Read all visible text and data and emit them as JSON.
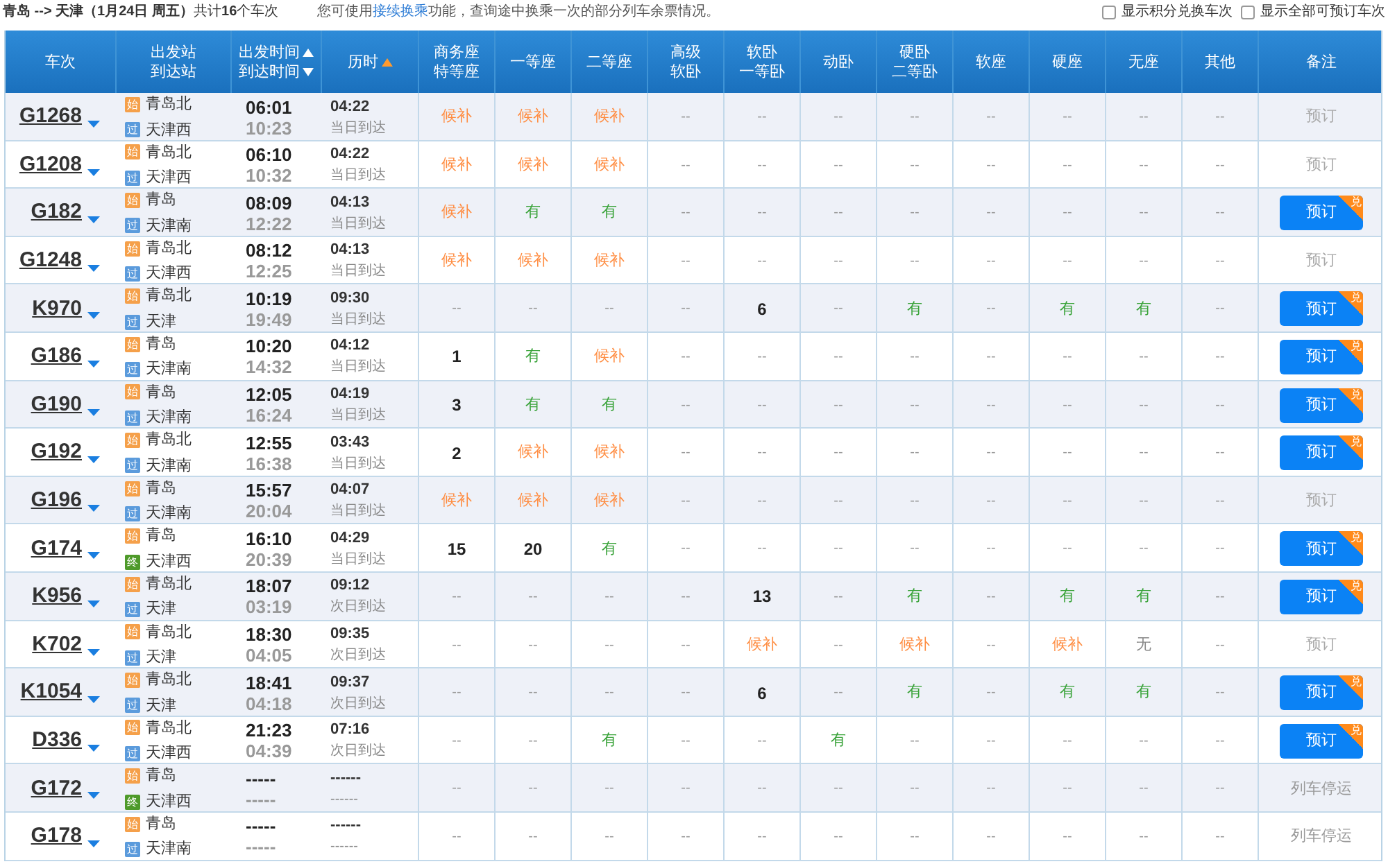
{
  "summary": "**青岛 --> 天津（1月24日 周五）**共计**16**个车次",
  "notice": {
    "before": "您可使用",
    "link": "接续换乘",
    "after": "功能，查询途中换乘一次的部分列车余票情况。"
  },
  "filters": [
    {
      "label": "显示积分兑换车次",
      "checked": false
    },
    {
      "label": "显示全部可预订车次",
      "checked": false
    }
  ],
  "columns": [
    {
      "lines": [
        {
          "text": "车次"
        }
      ]
    },
    {
      "lines": [
        {
          "text": "出发站"
        },
        {
          "text": "到达站"
        }
      ]
    },
    {
      "lines": [
        {
          "text": "出发时间",
          "sorted": true,
          "ascending": true,
          "active": false
        },
        {
          "text": "到达时间",
          "sorted": true,
          "ascending": false,
          "active": false
        }
      ]
    },
    {
      "lines": [
        {
          "text": "历时",
          "sorted": true,
          "ascending": true,
          "active": true
        }
      ]
    },
    {
      "lines": [
        {
          "text": "商务座"
        },
        {
          "text": "特等座"
        }
      ]
    },
    {
      "lines": [
        {
          "text": "一等座"
        }
      ]
    },
    {
      "lines": [
        {
          "text": "二等座"
        }
      ]
    },
    {
      "lines": [
        {
          "text": "高级"
        },
        {
          "text": "软卧"
        }
      ]
    },
    {
      "lines": [
        {
          "text": "软卧"
        },
        {
          "text": "一等卧"
        }
      ]
    },
    {
      "lines": [
        {
          "text": "动卧"
        }
      ]
    },
    {
      "lines": [
        {
          "text": "硬卧"
        },
        {
          "text": "二等卧"
        }
      ]
    },
    {
      "lines": [
        {
          "text": "软座"
        }
      ]
    },
    {
      "lines": [
        {
          "text": "硬座"
        }
      ]
    },
    {
      "lines": [
        {
          "text": "无座"
        }
      ]
    },
    {
      "lines": [
        {
          "text": "其他"
        }
      ]
    },
    {
      "lines": [
        {
          "text": "备注"
        }
      ]
    }
  ],
  "rows": [
    {
      "code": "G1268",
      "from": {
        "tag": "始",
        "kind": "start",
        "name": "青岛北"
      },
      "to": {
        "tag": "过",
        "kind": "pass",
        "name": "天津西"
      },
      "depart": "06:01",
      "arrive": "10:23",
      "duration": "04:22",
      "arrival_day": "当日到达",
      "seats": [
        {
          "text": "候补",
          "kind": "waitlist"
        },
        {
          "text": "候补",
          "kind": "waitlist"
        },
        {
          "text": "候补",
          "kind": "waitlist"
        },
        {
          "text": "--",
          "kind": "none"
        },
        {
          "text": "--",
          "kind": "none"
        },
        {
          "text": "--",
          "kind": "none"
        },
        {
          "text": "--",
          "kind": "none"
        },
        {
          "text": "--",
          "kind": "none"
        },
        {
          "text": "--",
          "kind": "none"
        },
        {
          "text": "--",
          "kind": "none"
        },
        {
          "text": "--",
          "kind": "none"
        }
      ],
      "remark": {
        "kind": "button",
        "text": "预订",
        "enabled": false
      }
    },
    {
      "code": "G1208",
      "from": {
        "tag": "始",
        "kind": "start",
        "name": "青岛北"
      },
      "to": {
        "tag": "过",
        "kind": "pass",
        "name": "天津西"
      },
      "depart": "06:10",
      "arrive": "10:32",
      "duration": "04:22",
      "arrival_day": "当日到达",
      "seats": [
        {
          "text": "候补",
          "kind": "waitlist"
        },
        {
          "text": "候补",
          "kind": "waitlist"
        },
        {
          "text": "候补",
          "kind": "waitlist"
        },
        {
          "text": "--",
          "kind": "none"
        },
        {
          "text": "--",
          "kind": "none"
        },
        {
          "text": "--",
          "kind": "none"
        },
        {
          "text": "--",
          "kind": "none"
        },
        {
          "text": "--",
          "kind": "none"
        },
        {
          "text": "--",
          "kind": "none"
        },
        {
          "text": "--",
          "kind": "none"
        },
        {
          "text": "--",
          "kind": "none"
        }
      ],
      "remark": {
        "kind": "button",
        "text": "预订",
        "enabled": false
      }
    },
    {
      "code": "G182",
      "from": {
        "tag": "始",
        "kind": "start",
        "name": "青岛"
      },
      "to": {
        "tag": "过",
        "kind": "pass",
        "name": "天津南"
      },
      "depart": "08:09",
      "arrive": "12:22",
      "duration": "04:13",
      "arrival_day": "当日到达",
      "seats": [
        {
          "text": "候补",
          "kind": "waitlist"
        },
        {
          "text": "有",
          "kind": "available"
        },
        {
          "text": "有",
          "kind": "available"
        },
        {
          "text": "--",
          "kind": "none"
        },
        {
          "text": "--",
          "kind": "none"
        },
        {
          "text": "--",
          "kind": "none"
        },
        {
          "text": "--",
          "kind": "none"
        },
        {
          "text": "--",
          "kind": "none"
        },
        {
          "text": "--",
          "kind": "none"
        },
        {
          "text": "--",
          "kind": "none"
        },
        {
          "text": "--",
          "kind": "none"
        }
      ],
      "remark": {
        "kind": "button",
        "text": "预订",
        "enabled": true,
        "badge": "兑"
      }
    },
    {
      "code": "G1248",
      "from": {
        "tag": "始",
        "kind": "start",
        "name": "青岛北"
      },
      "to": {
        "tag": "过",
        "kind": "pass",
        "name": "天津西"
      },
      "depart": "08:12",
      "arrive": "12:25",
      "duration": "04:13",
      "arrival_day": "当日到达",
      "seats": [
        {
          "text": "候补",
          "kind": "waitlist"
        },
        {
          "text": "候补",
          "kind": "waitlist"
        },
        {
          "text": "候补",
          "kind": "waitlist"
        },
        {
          "text": "--",
          "kind": "none"
        },
        {
          "text": "--",
          "kind": "none"
        },
        {
          "text": "--",
          "kind": "none"
        },
        {
          "text": "--",
          "kind": "none"
        },
        {
          "text": "--",
          "kind": "none"
        },
        {
          "text": "--",
          "kind": "none"
        },
        {
          "text": "--",
          "kind": "none"
        },
        {
          "text": "--",
          "kind": "none"
        }
      ],
      "remark": {
        "kind": "button",
        "text": "预订",
        "enabled": false
      }
    },
    {
      "code": "K970",
      "from": {
        "tag": "始",
        "kind": "start",
        "name": "青岛北"
      },
      "to": {
        "tag": "过",
        "kind": "pass",
        "name": "天津"
      },
      "depart": "10:19",
      "arrive": "19:49",
      "duration": "09:30",
      "arrival_day": "当日到达",
      "seats": [
        {
          "text": "--",
          "kind": "none"
        },
        {
          "text": "--",
          "kind": "none"
        },
        {
          "text": "--",
          "kind": "none"
        },
        {
          "text": "--",
          "kind": "none"
        },
        {
          "text": "6",
          "kind": "count"
        },
        {
          "text": "--",
          "kind": "none"
        },
        {
          "text": "有",
          "kind": "available"
        },
        {
          "text": "--",
          "kind": "none"
        },
        {
          "text": "有",
          "kind": "available"
        },
        {
          "text": "有",
          "kind": "available"
        },
        {
          "text": "--",
          "kind": "none"
        }
      ],
      "remark": {
        "kind": "button",
        "text": "预订",
        "enabled": true,
        "badge": "兑"
      }
    },
    {
      "code": "G186",
      "from": {
        "tag": "始",
        "kind": "start",
        "name": "青岛"
      },
      "to": {
        "tag": "过",
        "kind": "pass",
        "name": "天津南"
      },
      "depart": "10:20",
      "arrive": "14:32",
      "duration": "04:12",
      "arrival_day": "当日到达",
      "seats": [
        {
          "text": "1",
          "kind": "count"
        },
        {
          "text": "有",
          "kind": "available"
        },
        {
          "text": "候补",
          "kind": "waitlist"
        },
        {
          "text": "--",
          "kind": "none"
        },
        {
          "text": "--",
          "kind": "none"
        },
        {
          "text": "--",
          "kind": "none"
        },
        {
          "text": "--",
          "kind": "none"
        },
        {
          "text": "--",
          "kind": "none"
        },
        {
          "text": "--",
          "kind": "none"
        },
        {
          "text": "--",
          "kind": "none"
        },
        {
          "text": "--",
          "kind": "none"
        }
      ],
      "remark": {
        "kind": "button",
        "text": "预订",
        "enabled": true,
        "badge": "兑"
      }
    },
    {
      "code": "G190",
      "from": {
        "tag": "始",
        "kind": "start",
        "name": "青岛"
      },
      "to": {
        "tag": "过",
        "kind": "pass",
        "name": "天津南"
      },
      "depart": "12:05",
      "arrive": "16:24",
      "duration": "04:19",
      "arrival_day": "当日到达",
      "seats": [
        {
          "text": "3",
          "kind": "count"
        },
        {
          "text": "有",
          "kind": "available"
        },
        {
          "text": "有",
          "kind": "available"
        },
        {
          "text": "--",
          "kind": "none"
        },
        {
          "text": "--",
          "kind": "none"
        },
        {
          "text": "--",
          "kind": "none"
        },
        {
          "text": "--",
          "kind": "none"
        },
        {
          "text": "--",
          "kind": "none"
        },
        {
          "text": "--",
          "kind": "none"
        },
        {
          "text": "--",
          "kind": "none"
        },
        {
          "text": "--",
          "kind": "none"
        }
      ],
      "remark": {
        "kind": "button",
        "text": "预订",
        "enabled": true,
        "badge": "兑"
      }
    },
    {
      "code": "G192",
      "from": {
        "tag": "始",
        "kind": "start",
        "name": "青岛北"
      },
      "to": {
        "tag": "过",
        "kind": "pass",
        "name": "天津南"
      },
      "depart": "12:55",
      "arrive": "16:38",
      "duration": "03:43",
      "arrival_day": "当日到达",
      "seats": [
        {
          "text": "2",
          "kind": "count"
        },
        {
          "text": "候补",
          "kind": "waitlist"
        },
        {
          "text": "候补",
          "kind": "waitlist"
        },
        {
          "text": "--",
          "kind": "none"
        },
        {
          "text": "--",
          "kind": "none"
        },
        {
          "text": "--",
          "kind": "none"
        },
        {
          "text": "--",
          "kind": "none"
        },
        {
          "text": "--",
          "kind": "none"
        },
        {
          "text": "--",
          "kind": "none"
        },
        {
          "text": "--",
          "kind": "none"
        },
        {
          "text": "--",
          "kind": "none"
        }
      ],
      "remark": {
        "kind": "button",
        "text": "预订",
        "enabled": true,
        "badge": "兑"
      }
    },
    {
      "code": "G196",
      "from": {
        "tag": "始",
        "kind": "start",
        "name": "青岛"
      },
      "to": {
        "tag": "过",
        "kind": "pass",
        "name": "天津南"
      },
      "depart": "15:57",
      "arrive": "20:04",
      "duration": "04:07",
      "arrival_day": "当日到达",
      "seats": [
        {
          "text": "候补",
          "kind": "waitlist"
        },
        {
          "text": "候补",
          "kind": "waitlist"
        },
        {
          "text": "候补",
          "kind": "waitlist"
        },
        {
          "text": "--",
          "kind": "none"
        },
        {
          "text": "--",
          "kind": "none"
        },
        {
          "text": "--",
          "kind": "none"
        },
        {
          "text": "--",
          "kind": "none"
        },
        {
          "text": "--",
          "kind": "none"
        },
        {
          "text": "--",
          "kind": "none"
        },
        {
          "text": "--",
          "kind": "none"
        },
        {
          "text": "--",
          "kind": "none"
        }
      ],
      "remark": {
        "kind": "button",
        "text": "预订",
        "enabled": false
      }
    },
    {
      "code": "G174",
      "from": {
        "tag": "始",
        "kind": "start",
        "name": "青岛"
      },
      "to": {
        "tag": "终",
        "kind": "end",
        "name": "天津西"
      },
      "depart": "16:10",
      "arrive": "20:39",
      "duration": "04:29",
      "arrival_day": "当日到达",
      "seats": [
        {
          "text": "15",
          "kind": "count"
        },
        {
          "text": "20",
          "kind": "count"
        },
        {
          "text": "有",
          "kind": "available"
        },
        {
          "text": "--",
          "kind": "none"
        },
        {
          "text": "--",
          "kind": "none"
        },
        {
          "text": "--",
          "kind": "none"
        },
        {
          "text": "--",
          "kind": "none"
        },
        {
          "text": "--",
          "kind": "none"
        },
        {
          "text": "--",
          "kind": "none"
        },
        {
          "text": "--",
          "kind": "none"
        },
        {
          "text": "--",
          "kind": "none"
        }
      ],
      "remark": {
        "kind": "button",
        "text": "预订",
        "enabled": true,
        "badge": "兑"
      }
    },
    {
      "code": "K956",
      "from": {
        "tag": "始",
        "kind": "start",
        "name": "青岛北"
      },
      "to": {
        "tag": "过",
        "kind": "pass",
        "name": "天津"
      },
      "depart": "18:07",
      "arrive": "03:19",
      "duration": "09:12",
      "arrival_day": "次日到达",
      "seats": [
        {
          "text": "--",
          "kind": "none"
        },
        {
          "text": "--",
          "kind": "none"
        },
        {
          "text": "--",
          "kind": "none"
        },
        {
          "text": "--",
          "kind": "none"
        },
        {
          "text": "13",
          "kind": "count"
        },
        {
          "text": "--",
          "kind": "none"
        },
        {
          "text": "有",
          "kind": "available"
        },
        {
          "text": "--",
          "kind": "none"
        },
        {
          "text": "有",
          "kind": "available"
        },
        {
          "text": "有",
          "kind": "available"
        },
        {
          "text": "--",
          "kind": "none"
        }
      ],
      "remark": {
        "kind": "button",
        "text": "预订",
        "enabled": true,
        "badge": "兑"
      }
    },
    {
      "code": "K702",
      "from": {
        "tag": "始",
        "kind": "start",
        "name": "青岛北"
      },
      "to": {
        "tag": "过",
        "kind": "pass",
        "name": "天津"
      },
      "depart": "18:30",
      "arrive": "04:05",
      "duration": "09:35",
      "arrival_day": "次日到达",
      "seats": [
        {
          "text": "--",
          "kind": "none"
        },
        {
          "text": "--",
          "kind": "none"
        },
        {
          "text": "--",
          "kind": "none"
        },
        {
          "text": "--",
          "kind": "none"
        },
        {
          "text": "候补",
          "kind": "waitlist"
        },
        {
          "text": "--",
          "kind": "none"
        },
        {
          "text": "候补",
          "kind": "waitlist"
        },
        {
          "text": "--",
          "kind": "none"
        },
        {
          "text": "候补",
          "kind": "waitlist"
        },
        {
          "text": "无",
          "kind": "soldout"
        },
        {
          "text": "--",
          "kind": "none"
        }
      ],
      "remark": {
        "kind": "button",
        "text": "预订",
        "enabled": false
      }
    },
    {
      "code": "K1054",
      "from": {
        "tag": "始",
        "kind": "start",
        "name": "青岛北"
      },
      "to": {
        "tag": "过",
        "kind": "pass",
        "name": "天津"
      },
      "depart": "18:41",
      "arrive": "04:18",
      "duration": "09:37",
      "arrival_day": "次日到达",
      "seats": [
        {
          "text": "--",
          "kind": "none"
        },
        {
          "text": "--",
          "kind": "none"
        },
        {
          "text": "--",
          "kind": "none"
        },
        {
          "text": "--",
          "kind": "none"
        },
        {
          "text": "6",
          "kind": "count"
        },
        {
          "text": "--",
          "kind": "none"
        },
        {
          "text": "有",
          "kind": "available"
        },
        {
          "text": "--",
          "kind": "none"
        },
        {
          "text": "有",
          "kind": "available"
        },
        {
          "text": "有",
          "kind": "available"
        },
        {
          "text": "--",
          "kind": "none"
        }
      ],
      "remark": {
        "kind": "button",
        "text": "预订",
        "enabled": true,
        "badge": "兑"
      }
    },
    {
      "code": "D336",
      "from": {
        "tag": "始",
        "kind": "start",
        "name": "青岛北"
      },
      "to": {
        "tag": "过",
        "kind": "pass",
        "name": "天津西"
      },
      "depart": "21:23",
      "arrive": "04:39",
      "duration": "07:16",
      "arrival_day": "次日到达",
      "seats": [
        {
          "text": "--",
          "kind": "none"
        },
        {
          "text": "--",
          "kind": "none"
        },
        {
          "text": "有",
          "kind": "available"
        },
        {
          "text": "--",
          "kind": "none"
        },
        {
          "text": "--",
          "kind": "none"
        },
        {
          "text": "有",
          "kind": "available"
        },
        {
          "text": "--",
          "kind": "none"
        },
        {
          "text": "--",
          "kind": "none"
        },
        {
          "text": "--",
          "kind": "none"
        },
        {
          "text": "--",
          "kind": "none"
        },
        {
          "text": "--",
          "kind": "none"
        }
      ],
      "remark": {
        "kind": "button",
        "text": "预订",
        "enabled": true,
        "badge": "兑"
      }
    },
    {
      "code": "G172",
      "from": {
        "tag": "始",
        "kind": "start",
        "name": "青岛"
      },
      "to": {
        "tag": "终",
        "kind": "end",
        "name": "天津西"
      },
      "depart": "-----",
      "arrive": "-----",
      "duration": "------",
      "arrival_day": "------",
      "seats": [
        {
          "text": "--",
          "kind": "none"
        },
        {
          "text": "--",
          "kind": "none"
        },
        {
          "text": "--",
          "kind": "none"
        },
        {
          "text": "--",
          "kind": "none"
        },
        {
          "text": "--",
          "kind": "none"
        },
        {
          "text": "--",
          "kind": "none"
        },
        {
          "text": "--",
          "kind": "none"
        },
        {
          "text": "--",
          "kind": "none"
        },
        {
          "text": "--",
          "kind": "none"
        },
        {
          "text": "--",
          "kind": "none"
        },
        {
          "text": "--",
          "kind": "none"
        }
      ],
      "remark": {
        "kind": "text",
        "text": "列车停运"
      }
    },
    {
      "code": "G178",
      "from": {
        "tag": "始",
        "kind": "start",
        "name": "青岛"
      },
      "to": {
        "tag": "过",
        "kind": "pass",
        "name": "天津南"
      },
      "depart": "-----",
      "arrive": "-----",
      "duration": "------",
      "arrival_day": "------",
      "seats": [
        {
          "text": "--",
          "kind": "none"
        },
        {
          "text": "--",
          "kind": "none"
        },
        {
          "text": "--",
          "kind": "none"
        },
        {
          "text": "--",
          "kind": "none"
        },
        {
          "text": "--",
          "kind": "none"
        },
        {
          "text": "--",
          "kind": "none"
        },
        {
          "text": "--",
          "kind": "none"
        },
        {
          "text": "--",
          "kind": "none"
        },
        {
          "text": "--",
          "kind": "none"
        },
        {
          "text": "--",
          "kind": "none"
        },
        {
          "text": "--",
          "kind": "none"
        }
      ],
      "remark": {
        "kind": "text",
        "text": "列车停运"
      }
    }
  ]
}
